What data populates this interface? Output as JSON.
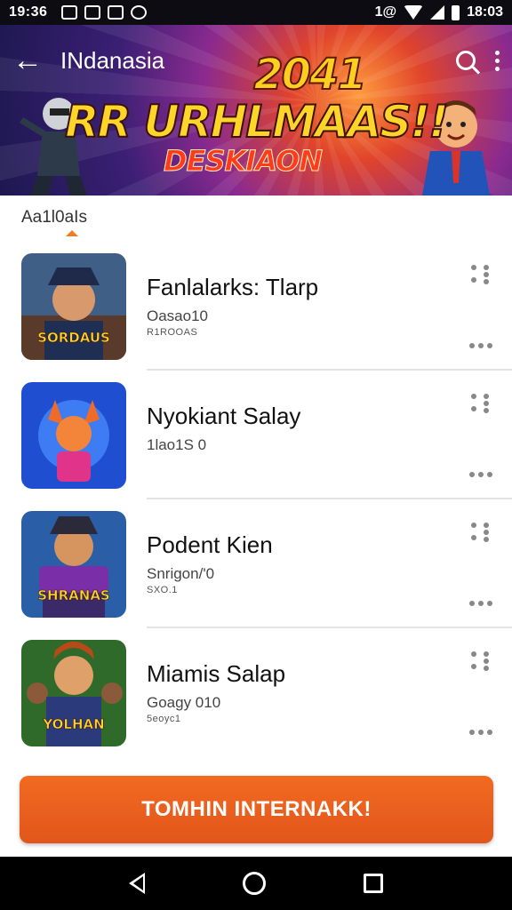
{
  "status_bar": {
    "time": "19:36",
    "right_time": "18:03",
    "right_label": "1@"
  },
  "app_bar": {
    "title": "INdanasia",
    "icons": [
      "back-arrow-icon",
      "search-icon",
      "more-vert-icon"
    ]
  },
  "banner": {
    "line1": "2041",
    "line2": "RR URHLMAAS!!",
    "line3": "DESKIAON"
  },
  "section": {
    "label": "Aa1l0aIs"
  },
  "items": [
    {
      "title": "Fanlalarks: Tlarp",
      "subtitle": "Oasao10",
      "meta": "R1ROOAS",
      "thumb_label": "SORDAUS"
    },
    {
      "title": "Nyokiant Salay",
      "subtitle": "1lao1S 0",
      "meta": "",
      "thumb_label": ""
    },
    {
      "title": "Podent Kien",
      "subtitle": "Snrigon/'0",
      "meta": "SXO.1",
      "thumb_label": "SHRANAS"
    },
    {
      "title": "Miamis Salap",
      "subtitle": "Goagy 010",
      "meta": "5eoyc1",
      "thumb_label": "YOLHAN"
    }
  ],
  "cta": {
    "label": "TOMHIN INTERNAKK!"
  },
  "colors": {
    "accent": "#ef6a22",
    "text": "#111111",
    "divider": "#e3e3e3"
  }
}
